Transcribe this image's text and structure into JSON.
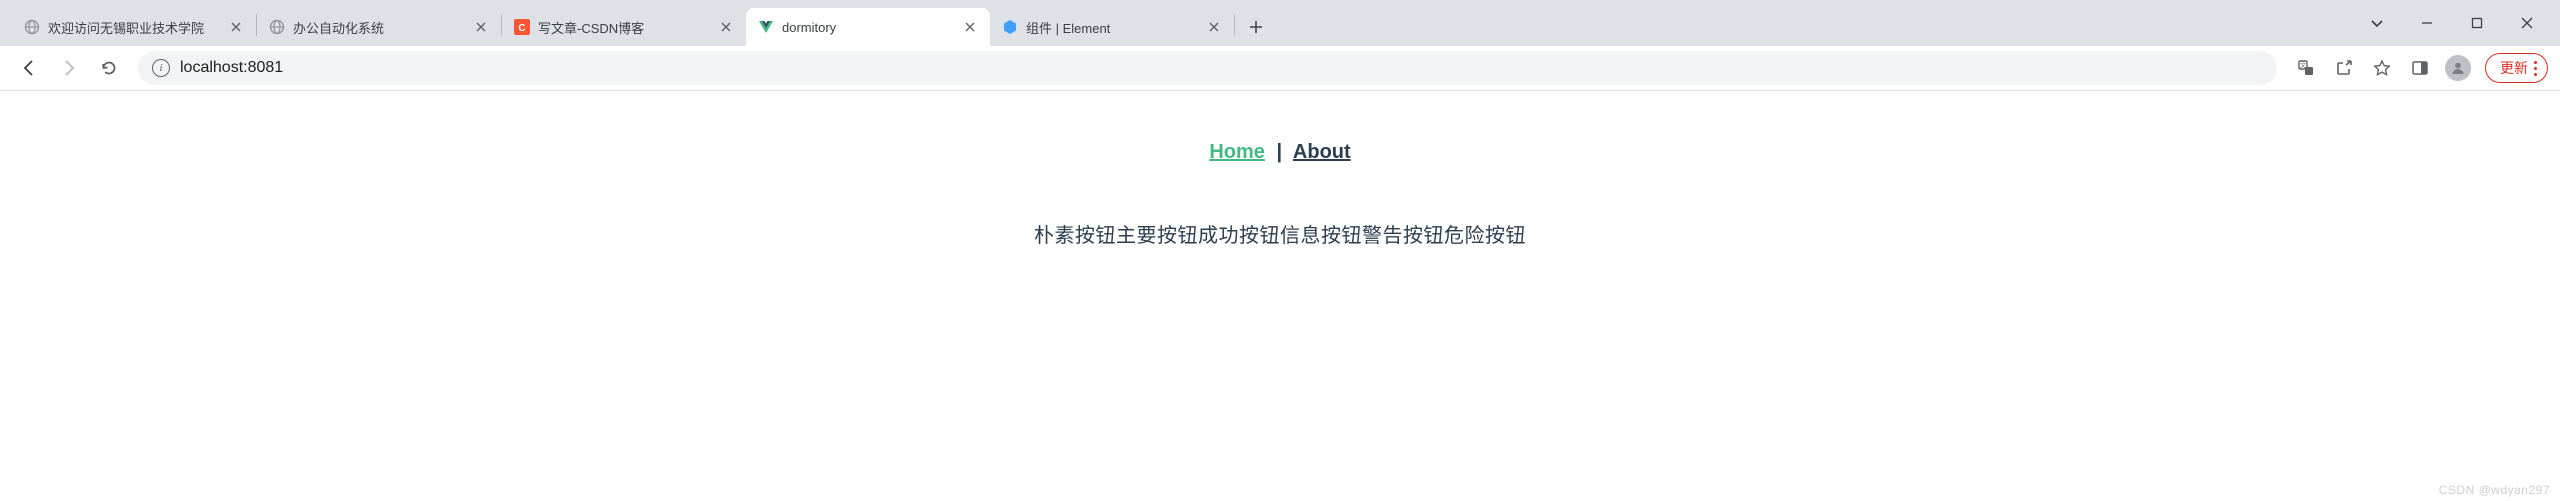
{
  "tabs": [
    {
      "title": "欢迎访问无锡职业技术学院",
      "favicon": "globe"
    },
    {
      "title": "办公自动化系统",
      "favicon": "globe"
    },
    {
      "title": "写文章-CSDN博客",
      "favicon": "csdn"
    },
    {
      "title": "dormitory",
      "favicon": "vue",
      "active": true
    },
    {
      "title": "组件 | Element",
      "favicon": "element"
    }
  ],
  "toolbar": {
    "url": "localhost:8081",
    "update_label": "更新"
  },
  "page": {
    "nav": {
      "home": "Home",
      "sep": "|",
      "about": "About"
    },
    "buttons_text": "朴素按钮主要按钮成功按钮信息按钮警告按钮危险按钮"
  },
  "watermark": "CSDN @wdyan297"
}
